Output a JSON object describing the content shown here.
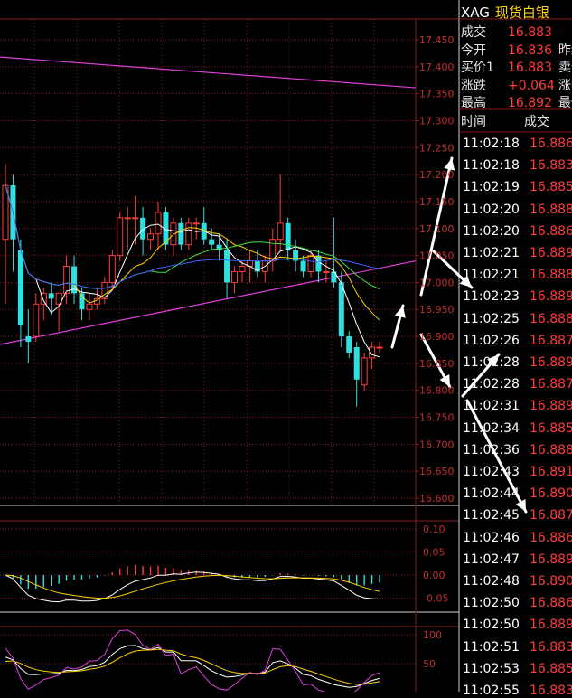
{
  "price_axis": {
    "labels": [
      "17.450",
      "17.400",
      "17.350",
      "17.300",
      "17.250",
      "17.200",
      "17.150",
      "17.100",
      "17.050",
      "17.000",
      "16.950",
      "16.900",
      "16.850",
      "16.800",
      "16.750",
      "16.700",
      "16.650",
      "16.600"
    ]
  },
  "macd_axis": {
    "labels": [
      "0.10",
      "0.05",
      "0.00",
      "-0.05"
    ]
  },
  "kdj_axis": {
    "labels": [
      "100",
      "50"
    ]
  },
  "quote": {
    "symbol": "XAG",
    "name": "现货白银",
    "rows": [
      {
        "label": "成交",
        "value": "16.883",
        "label2": ""
      },
      {
        "label": "今开",
        "value": "16.836",
        "label2": "昨结"
      },
      {
        "label": "买价1",
        "value": "16.883",
        "label2": "卖价"
      },
      {
        "label": "涨跌",
        "value": "+0.064",
        "label2": "涨幅"
      },
      {
        "label": "最高",
        "value": "16.892",
        "label2": "最低"
      }
    ]
  },
  "trades": {
    "header_time": "时间",
    "header_price": "成交",
    "rows": [
      {
        "time": "11:02:18",
        "price": "16.886"
      },
      {
        "time": "11:02:18",
        "price": "16.883"
      },
      {
        "time": "11:02:19",
        "price": "16.885"
      },
      {
        "time": "11:02:20",
        "price": "16.888"
      },
      {
        "time": "11:02:20",
        "price": "16.886"
      },
      {
        "time": "11:02:21",
        "price": "16.889"
      },
      {
        "time": "11:02:21",
        "price": "16.888"
      },
      {
        "time": "11:02:23",
        "price": "16.889"
      },
      {
        "time": "11:02:25",
        "price": "16.888"
      },
      {
        "time": "11:02:26",
        "price": "16.887"
      },
      {
        "time": "11:02:28",
        "price": "16.889"
      },
      {
        "time": "11:02:28",
        "price": "16.887"
      },
      {
        "time": "11:02:31",
        "price": "16.889"
      },
      {
        "time": "11:02:34",
        "price": "16.885"
      },
      {
        "time": "11:02:36",
        "price": "16.888"
      },
      {
        "time": "11:02:43",
        "price": "16.891"
      },
      {
        "time": "11:02:44",
        "price": "16.890"
      },
      {
        "time": "11:02:45",
        "price": "16.887"
      },
      {
        "time": "11:02:46",
        "price": "16.886"
      },
      {
        "time": "11:02:47",
        "price": "16.889"
      },
      {
        "time": "11:02:48",
        "price": "16.890"
      },
      {
        "time": "11:02:50",
        "price": "16.886"
      },
      {
        "time": "11:02:50",
        "price": "16.889"
      },
      {
        "time": "11:02:51",
        "price": "16.883"
      },
      {
        "time": "11:02:53",
        "price": "16.885"
      },
      {
        "time": "11:02:55",
        "price": "16.883"
      }
    ]
  },
  "colors": {
    "up": "#ff3b3b",
    "down": "#30e0e0",
    "grid": "#8a1a1a",
    "trend": "#e040e0",
    "ma5": "#ffffff",
    "ma10": "#ffd200",
    "ma20": "#40e040",
    "ma60": "#4060ff"
  },
  "candles": [
    {
      "o": 17.08,
      "h": 17.22,
      "l": 16.96,
      "c": 17.18
    },
    {
      "o": 17.18,
      "h": 17.2,
      "l": 17.02,
      "c": 17.08
    },
    {
      "o": 17.06,
      "h": 17.08,
      "l": 16.88,
      "c": 16.92
    },
    {
      "o": 16.9,
      "h": 16.95,
      "l": 16.85,
      "c": 16.89
    },
    {
      "o": 16.9,
      "h": 16.98,
      "l": 16.89,
      "c": 16.96
    },
    {
      "o": 16.96,
      "h": 16.99,
      "l": 16.93,
      "c": 16.98
    },
    {
      "o": 16.98,
      "h": 17.0,
      "l": 16.94,
      "c": 16.97
    },
    {
      "o": 16.96,
      "h": 16.98,
      "l": 16.91,
      "c": 16.98
    },
    {
      "o": 16.98,
      "h": 17.05,
      "l": 16.96,
      "c": 17.03
    },
    {
      "o": 17.03,
      "h": 17.05,
      "l": 16.96,
      "c": 16.98
    },
    {
      "o": 16.98,
      "h": 16.99,
      "l": 16.93,
      "c": 16.95
    },
    {
      "o": 16.95,
      "h": 16.98,
      "l": 16.93,
      "c": 16.96
    },
    {
      "o": 16.96,
      "h": 16.99,
      "l": 16.95,
      "c": 16.97
    },
    {
      "o": 16.97,
      "h": 17.01,
      "l": 16.96,
      "c": 17.0
    },
    {
      "o": 17.0,
      "h": 17.06,
      "l": 16.99,
      "c": 17.05
    },
    {
      "o": 17.05,
      "h": 17.13,
      "l": 17.04,
      "c": 17.12
    },
    {
      "o": 17.12,
      "h": 17.14,
      "l": 17.06,
      "c": 17.12
    },
    {
      "o": 17.12,
      "h": 17.16,
      "l": 17.07,
      "c": 17.12
    },
    {
      "o": 17.12,
      "h": 17.14,
      "l": 17.05,
      "c": 17.08
    },
    {
      "o": 17.08,
      "h": 17.1,
      "l": 17.06,
      "c": 17.09
    },
    {
      "o": 17.09,
      "h": 17.15,
      "l": 17.06,
      "c": 17.13
    },
    {
      "o": 17.13,
      "h": 17.14,
      "l": 17.06,
      "c": 17.07
    },
    {
      "o": 17.07,
      "h": 17.12,
      "l": 17.05,
      "c": 17.11
    },
    {
      "o": 17.11,
      "h": 17.12,
      "l": 17.06,
      "c": 17.07
    },
    {
      "o": 17.07,
      "h": 17.12,
      "l": 17.06,
      "c": 17.11
    },
    {
      "o": 17.11,
      "h": 17.12,
      "l": 17.08,
      "c": 17.11
    },
    {
      "o": 17.11,
      "h": 17.14,
      "l": 17.07,
      "c": 17.08
    },
    {
      "o": 17.08,
      "h": 17.1,
      "l": 17.06,
      "c": 17.07
    },
    {
      "o": 17.07,
      "h": 17.09,
      "l": 17.04,
      "c": 17.06
    },
    {
      "o": 17.06,
      "h": 17.08,
      "l": 16.97,
      "c": 17.0
    },
    {
      "o": 17.0,
      "h": 17.03,
      "l": 16.98,
      "c": 17.02
    },
    {
      "o": 17.02,
      "h": 17.04,
      "l": 17.0,
      "c": 17.03
    },
    {
      "o": 17.03,
      "h": 17.06,
      "l": 17.0,
      "c": 17.04
    },
    {
      "o": 17.04,
      "h": 17.06,
      "l": 17.01,
      "c": 17.02
    },
    {
      "o": 17.02,
      "h": 17.05,
      "l": 17.0,
      "c": 17.04
    },
    {
      "o": 17.04,
      "h": 17.1,
      "l": 17.02,
      "c": 17.08
    },
    {
      "o": 17.08,
      "h": 17.2,
      "l": 17.06,
      "c": 17.11
    },
    {
      "o": 17.11,
      "h": 17.12,
      "l": 17.04,
      "c": 17.06
    },
    {
      "o": 17.06,
      "h": 17.08,
      "l": 17.02,
      "c": 17.04
    },
    {
      "o": 17.04,
      "h": 17.05,
      "l": 17.01,
      "c": 17.02
    },
    {
      "o": 17.02,
      "h": 17.06,
      "l": 17.01,
      "c": 17.05
    },
    {
      "o": 17.05,
      "h": 17.06,
      "l": 17.0,
      "c": 17.02
    },
    {
      "o": 17.02,
      "h": 17.04,
      "l": 17.0,
      "c": 17.02
    },
    {
      "o": 17.02,
      "h": 17.12,
      "l": 16.99,
      "c": 17.0
    },
    {
      "o": 17.0,
      "h": 17.02,
      "l": 16.88,
      "c": 16.9
    },
    {
      "o": 16.9,
      "h": 16.91,
      "l": 16.86,
      "c": 16.87
    },
    {
      "o": 16.88,
      "h": 16.89,
      "l": 16.77,
      "c": 16.82
    },
    {
      "o": 16.81,
      "h": 16.87,
      "l": 16.8,
      "c": 16.86
    },
    {
      "o": 16.86,
      "h": 16.89,
      "l": 16.84,
      "c": 16.88
    },
    {
      "o": 16.88,
      "h": 16.89,
      "l": 16.87,
      "c": 16.88
    }
  ]
}
